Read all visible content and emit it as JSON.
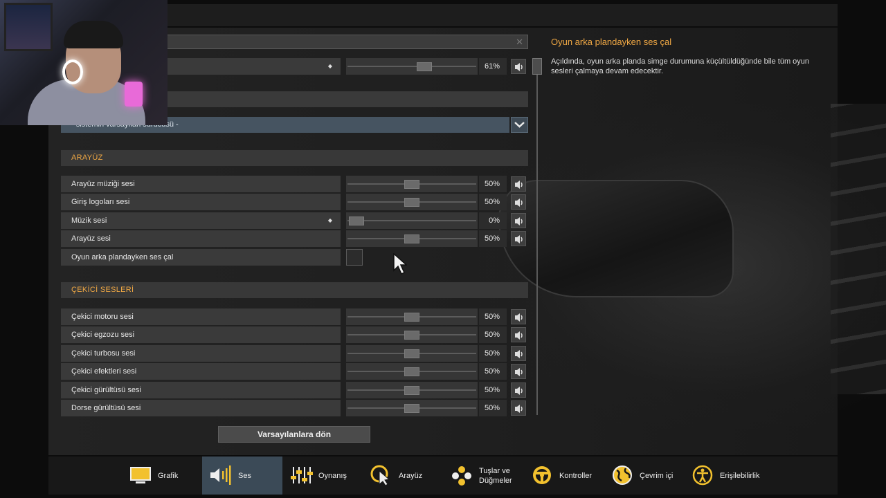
{
  "info": {
    "title": "Oyun arka plandayken ses çal",
    "text": "Açıldında, oyun arka planda simge durumuna küçültüldüğünde bile tüm oyun sesleri çalmaya devam edecektir."
  },
  "master": {
    "value": "61%",
    "level": 0.61
  },
  "audio_device": {
    "selected": "- sistemin varsayılan sürücüsü -"
  },
  "sections": {
    "interface": "ARAYÜZ",
    "tractor": "ÇEKİCİ SESLERİ"
  },
  "interface_rows": [
    {
      "label": "Arayüz müziği sesi",
      "value": "50%",
      "level": 0.5
    },
    {
      "label": "Giriş logoları sesi",
      "value": "50%",
      "level": 0.5
    },
    {
      "label": "Müzik sesi",
      "value": "0%",
      "level": 0.0
    },
    {
      "label": "Arayüz sesi",
      "value": "50%",
      "level": 0.5
    }
  ],
  "background_audio": {
    "label": "Oyun arka plandayken ses çal",
    "checked": false
  },
  "tractor_rows": [
    {
      "label": "Çekici motoru sesi",
      "value": "50%",
      "level": 0.5
    },
    {
      "label": "Çekici egzozu sesi",
      "value": "50%",
      "level": 0.5
    },
    {
      "label": "Çekici turbosu sesi",
      "value": "50%",
      "level": 0.5
    },
    {
      "label": "Çekici efektleri sesi",
      "value": "50%",
      "level": 0.5
    },
    {
      "label": "Çekici gürültüsü sesi",
      "value": "50%",
      "level": 0.5
    },
    {
      "label": "Dorse gürültüsü sesi",
      "value": "50%",
      "level": 0.5
    }
  ],
  "reset_label": "Varsayılanlara dön",
  "tabs": [
    {
      "label": "Grafik",
      "icon": "monitor-icon"
    },
    {
      "label": "Ses",
      "icon": "speaker-icon",
      "active": true
    },
    {
      "label": "Oynanış",
      "icon": "sliders-icon"
    },
    {
      "label": "Arayüz",
      "icon": "cursor-icon"
    },
    {
      "label": "Tuşlar ve Düğmeler",
      "icon": "gamepad-buttons-icon"
    },
    {
      "label": "Kontroller",
      "icon": "steering-wheel-icon"
    },
    {
      "label": "Çevrim içi",
      "icon": "globe-icon"
    },
    {
      "label": "Erişilebilirlik",
      "icon": "accessibility-icon"
    }
  ],
  "colors": {
    "accent": "#f0a844",
    "active_tab": "#3b4a57",
    "dropdown": "#465461"
  }
}
